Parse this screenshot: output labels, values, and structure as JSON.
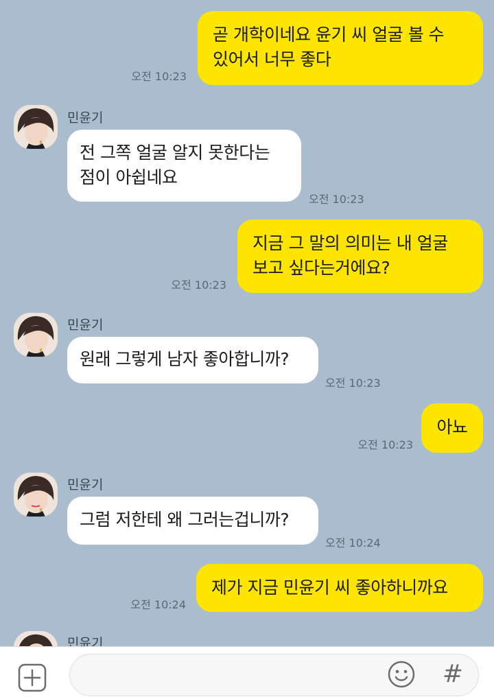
{
  "contact": {
    "name": "민윤기"
  },
  "messages": [
    {
      "from": "me",
      "text": "곧 개학이네요 윤기 씨 얼굴 볼 수\n있어서 너무 좋다",
      "time": "오전 10:23"
    },
    {
      "from": "them",
      "sender": "민윤기",
      "text": "전 그쪽 얼굴 알지 못한다는\n점이 아쉽네요",
      "time": "오전 10:23"
    },
    {
      "from": "me",
      "text": "지금 그 말의 의미는 내 얼굴\n보고 싶다는거에요?",
      "time": "오전 10:23"
    },
    {
      "from": "them",
      "sender": "민윤기",
      "text": "원래 그렇게 남자 좋아합니까?",
      "time": "오전 10:23"
    },
    {
      "from": "me",
      "text": "아뇨",
      "time": "오전 10:23"
    },
    {
      "from": "them",
      "sender": "민윤기",
      "text": "그럼 저한테 왜 그러는겁니까?",
      "time": "오전 10:24"
    },
    {
      "from": "me",
      "text": "제가 지금 민윤기 씨 좋아하니까요",
      "time": "오전 10:24"
    },
    {
      "from": "them",
      "sender": "민윤기",
      "text": "",
      "time": ""
    }
  ],
  "input": {
    "value": "",
    "placeholder": ""
  },
  "icons": {
    "attach": "plus-square-icon",
    "emoji": "smiley-icon",
    "hashtag": "hash-icon"
  },
  "colors": {
    "background": "#a9bdce",
    "my_bubble": "#fee500",
    "their_bubble": "#ffffff"
  },
  "hashtag_glyph": "#"
}
